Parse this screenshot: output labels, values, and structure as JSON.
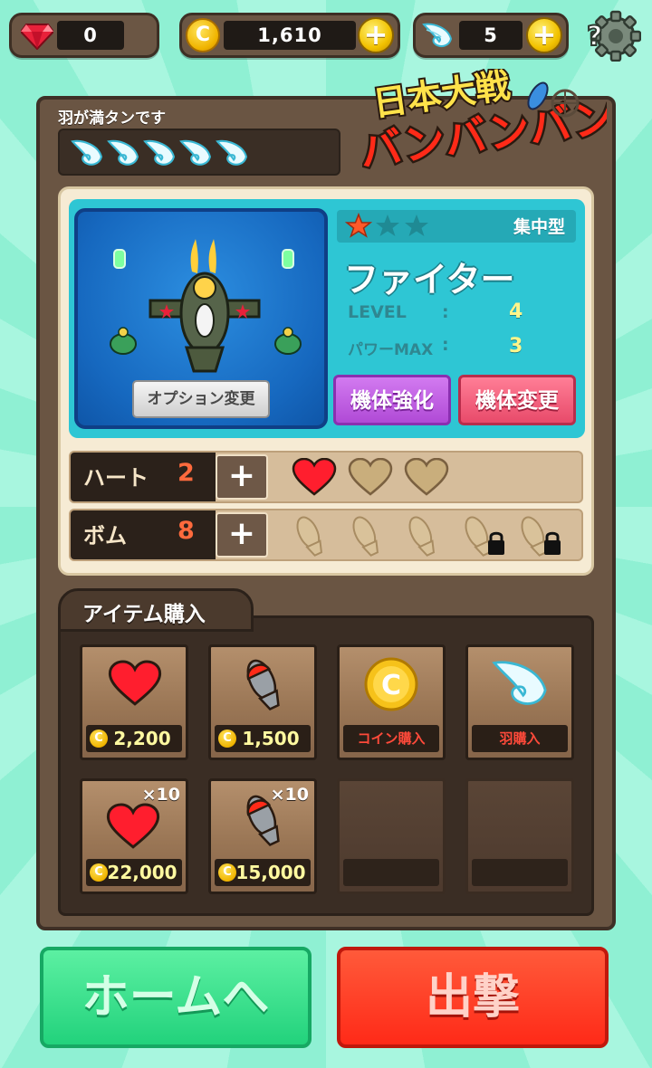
{
  "topbar": {
    "gems": "0",
    "coins": "1,610",
    "wings": "5"
  },
  "feathers": {
    "status": "羽が満タンです",
    "count": 5
  },
  "logo": {
    "line1": "日本大戦",
    "line2": "バンバンバン"
  },
  "ship": {
    "type": "集中型",
    "name": "ファイター",
    "stars": 1,
    "stars_max": 3,
    "level_label": "LEVEL",
    "level_value": "4",
    "power_label": "パワーMAX",
    "power_value": "3",
    "option_button": "オプション変更",
    "upgrade_button": "機体強化",
    "change_button": "機体変更"
  },
  "stock": {
    "heart_label": "ハート",
    "heart_count": "2",
    "bomb_label": "ボム",
    "bomb_count": "8"
  },
  "shop": {
    "title": "アイテム購入",
    "items": [
      {
        "price": "2,200"
      },
      {
        "price": "1,500"
      },
      {
        "label": "コイン購入"
      },
      {
        "label": "羽購入"
      },
      {
        "price": "22,000",
        "multiplier": "×10"
      },
      {
        "price": "15,000",
        "multiplier": "×10"
      }
    ]
  },
  "buttons": {
    "home": "ホームへ",
    "sortie": "出撃"
  },
  "colors": {
    "background": "#9af3d8",
    "panel": "#6a5543",
    "accent_teal": "#2ec6d4",
    "home_green": "#22d27c",
    "sortie_red": "#ff2a18"
  }
}
